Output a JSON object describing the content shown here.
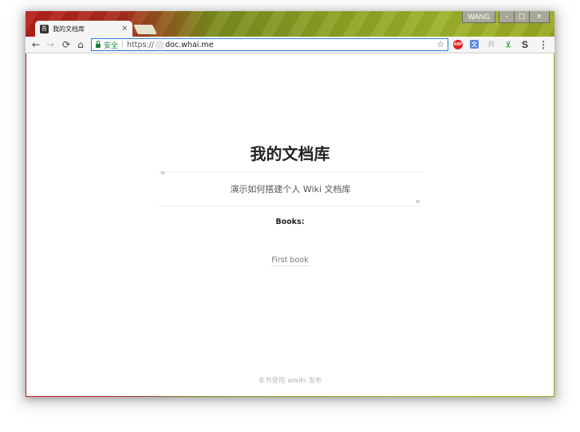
{
  "window": {
    "user": "WANG",
    "controls": {
      "minimize": "–",
      "maximize": "□",
      "close": "×"
    }
  },
  "tab": {
    "title": "我的文档库",
    "favicon_glyph": "吾",
    "close": "×"
  },
  "toolbar": {
    "back": "←",
    "forward": "→",
    "reload": "⟳",
    "home": "⌂",
    "secure_label": "安全",
    "url_scheme": "https://",
    "url_host": "doc.whai.me",
    "star": "☆",
    "extensions": {
      "abp": "ABP",
      "translate": "文",
      "r": "R",
      "pin": "⊻",
      "s": "S"
    },
    "menu": "⋮"
  },
  "page": {
    "title": "我的文档库",
    "quote_open": "❞",
    "quote_close": "❞",
    "description": "演示如何搭建个人 Wiki 文档库",
    "books_label": "Books:",
    "books": [
      "First book"
    ],
    "footer": "本书使用 wwiki 发布"
  },
  "colors": {
    "omnibox_border": "#2f7de1",
    "secure_green": "#188038",
    "title_text": "#222222"
  }
}
